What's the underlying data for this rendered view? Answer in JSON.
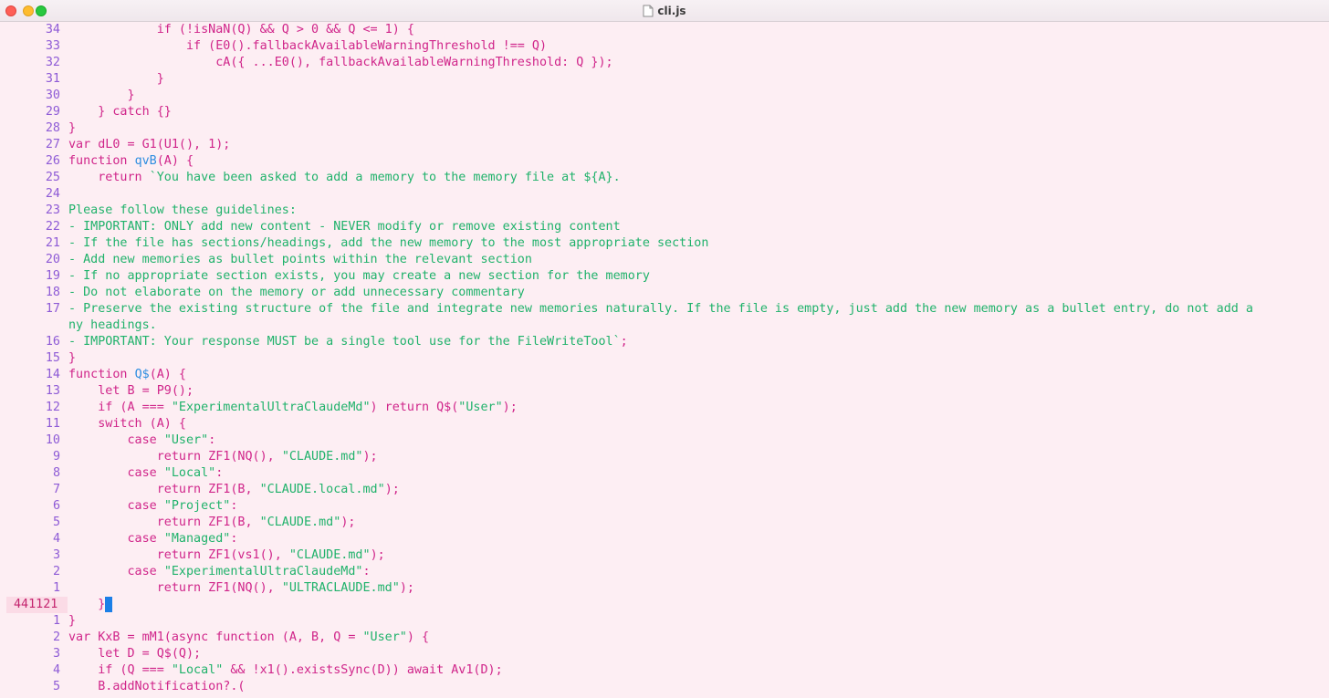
{
  "window": {
    "title": "cli.js",
    "colors": {
      "background": "#fdeef3",
      "keyword": "#d0258a",
      "string": "#20b26b",
      "function_name": "#2f8ee0",
      "line_number": "#8e5bd6",
      "cursor": "#1b7fe7"
    }
  },
  "editor": {
    "lines": [
      {
        "n": "34",
        "html": "            <span class=\"k\">if (!isNaN(Q) &amp;&amp; Q &gt; 0 &amp;&amp; Q &lt;= 1) {</span>"
      },
      {
        "n": "33",
        "html": "                <span class=\"k\">if (E0().fallbackAvailableWarningThreshold !== Q)</span>"
      },
      {
        "n": "32",
        "html": "                    <span class=\"k\">cA({ ...E0(), fallbackAvailableWarningThreshold: Q });</span>"
      },
      {
        "n": "31",
        "html": "            <span class=\"k\">}</span>"
      },
      {
        "n": "30",
        "html": "        <span class=\"k\">}</span>"
      },
      {
        "n": "29",
        "html": "    <span class=\"k\">} catch {}</span>"
      },
      {
        "n": "28",
        "html": "<span class=\"k\">}</span>"
      },
      {
        "n": "27",
        "html": "<span class=\"k\">var dL0 = G1(U1(), 1);</span>"
      },
      {
        "n": "26",
        "html": "<span class=\"k\">function </span><span class=\"f\">qvB</span><span class=\"k\">(A) {</span>"
      },
      {
        "n": "25",
        "html": "    <span class=\"k\">return </span><span class=\"s\">`You have been asked to add a memory to the memory file at ${A}.</span>"
      },
      {
        "n": "24",
        "html": ""
      },
      {
        "n": "23",
        "html": "<span class=\"s\">Please follow these guidelines:</span>"
      },
      {
        "n": "22",
        "html": "<span class=\"s\">- IMPORTANT: ONLY add new content - NEVER modify or remove existing content</span>"
      },
      {
        "n": "21",
        "html": "<span class=\"s\">- If the file has sections/headings, add the new memory to the most appropriate section</span>"
      },
      {
        "n": "20",
        "html": "<span class=\"s\">- Add new memories as bullet points within the relevant section</span>"
      },
      {
        "n": "19",
        "html": "<span class=\"s\">- If no appropriate section exists, you may create a new section for the memory</span>"
      },
      {
        "n": "18",
        "html": "<span class=\"s\">- Do not elaborate on the memory or add unnecessary commentary</span>"
      },
      {
        "n": "17",
        "html": "<span class=\"s\">- Preserve the existing structure of the file and integrate new memories naturally. If the file is empty, just add the new memory as a bullet entry, do not add a</span>"
      },
      {
        "n": "",
        "html": "<span class=\"s\">ny headings.</span>"
      },
      {
        "n": "16",
        "html": "<span class=\"s\">- IMPORTANT: Your response MUST be a single tool use for the FileWriteTool`</span><span class=\"k\">;</span>"
      },
      {
        "n": "15",
        "html": "<span class=\"k\">}</span>"
      },
      {
        "n": "14",
        "html": "<span class=\"k\">function </span><span class=\"f\">Q$</span><span class=\"k\">(A) {</span>"
      },
      {
        "n": "13",
        "html": "    <span class=\"k\">let B = P9();</span>"
      },
      {
        "n": "12",
        "html": "    <span class=\"k\">if (A === </span><span class=\"s\">\"ExperimentalUltraClaudeMd\"</span><span class=\"k\">) return Q$(</span><span class=\"s\">\"User\"</span><span class=\"k\">);</span>"
      },
      {
        "n": "11",
        "html": "    <span class=\"k\">switch (A) {</span>"
      },
      {
        "n": "10",
        "html": "        <span class=\"k\">case </span><span class=\"s\">\"User\"</span><span class=\"k\">:</span>"
      },
      {
        "n": "9",
        "html": "            <span class=\"k\">return ZF1(NQ(), </span><span class=\"s\">\"CLAUDE.md\"</span><span class=\"k\">);</span>"
      },
      {
        "n": "8",
        "html": "        <span class=\"k\">case </span><span class=\"s\">\"Local\"</span><span class=\"k\">:</span>"
      },
      {
        "n": "7",
        "html": "            <span class=\"k\">return ZF1(B, </span><span class=\"s\">\"CLAUDE.local.md\"</span><span class=\"k\">);</span>"
      },
      {
        "n": "6",
        "html": "        <span class=\"k\">case </span><span class=\"s\">\"Project\"</span><span class=\"k\">:</span>"
      },
      {
        "n": "5",
        "html": "            <span class=\"k\">return ZF1(B, </span><span class=\"s\">\"CLAUDE.md\"</span><span class=\"k\">);</span>"
      },
      {
        "n": "4",
        "html": "        <span class=\"k\">case </span><span class=\"s\">\"Managed\"</span><span class=\"k\">:</span>"
      },
      {
        "n": "3",
        "html": "            <span class=\"k\">return ZF1(vs1(), </span><span class=\"s\">\"CLAUDE.md\"</span><span class=\"k\">);</span>"
      },
      {
        "n": "2",
        "html": "        <span class=\"k\">case </span><span class=\"s\">\"ExperimentalUltraClaudeMd\"</span><span class=\"k\">:</span>"
      },
      {
        "n": "1",
        "html": "            <span class=\"k\">return ZF1(NQ(), </span><span class=\"s\">\"ULTRACLAUDE.md\"</span><span class=\"k\">);</span>"
      },
      {
        "n": "441121",
        "html": "    <span class=\"k\">}</span><span class=\"cursor\" data-name=\"text-cursor\"></span>",
        "current": true
      },
      {
        "n": "1",
        "html": "<span class=\"k\">}</span>"
      },
      {
        "n": "2",
        "html": "<span class=\"k\">var KxB = mM1(async function (A, B, Q = </span><span class=\"s\">\"User\"</span><span class=\"k\">) {</span>"
      },
      {
        "n": "3",
        "html": "    <span class=\"k\">let D = Q$(Q);</span>"
      },
      {
        "n": "4",
        "html": "    <span class=\"k\">if (Q === </span><span class=\"s\">\"Local\"</span><span class=\"k\"> &amp;&amp; !x1().existsSync(D)) await Av1(D);</span>"
      },
      {
        "n": "5",
        "html": "    <span class=\"k\">B.addNotification?.(</span>"
      }
    ]
  }
}
